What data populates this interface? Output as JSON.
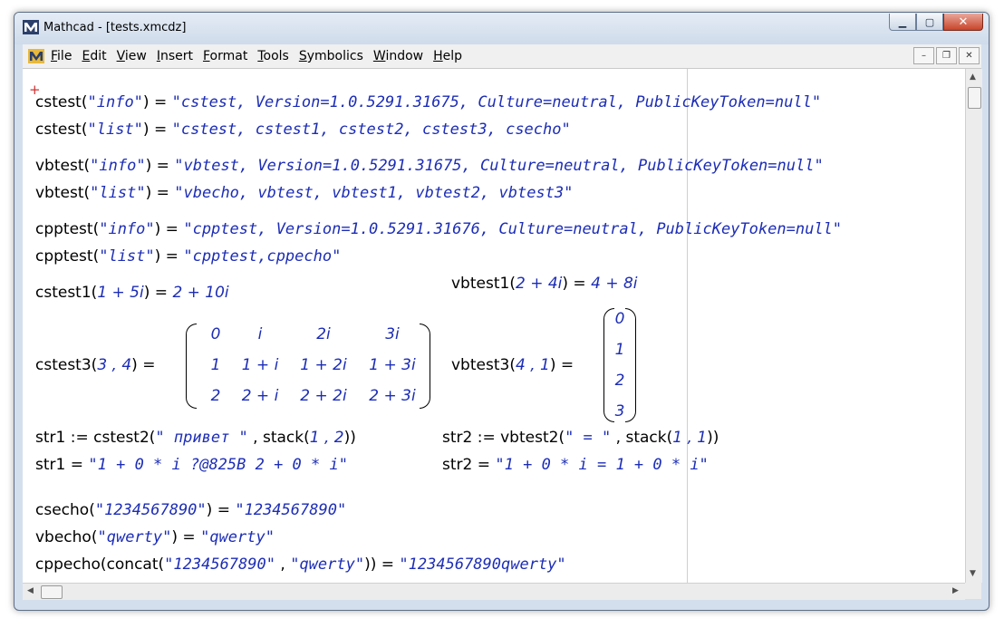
{
  "window": {
    "title": "Mathcad - [tests.xmcdz]",
    "minimize": "▁",
    "maximize": "▢",
    "close": "✕"
  },
  "menu": [
    "File",
    "Edit",
    "View",
    "Insert",
    "Format",
    "Tools",
    "Symbolics",
    "Window",
    "Help"
  ],
  "mdi": {
    "minimize": "–",
    "restore": "❐",
    "close": "✕"
  },
  "cursor_glyph": "+",
  "icons": {
    "app": "mathcad-logo-icon",
    "doc": "mathcad-document-icon"
  },
  "colors": {
    "string_literal": "#1c2db6",
    "cursor": "#d03030"
  },
  "worksheet": {
    "cstest_info": {
      "fn": "cstest",
      "arg": "\"info\"",
      "op": " = ",
      "result": "\"cstest, Version=1.0.5291.31675, Culture=neutral, PublicKeyToken=null\""
    },
    "cstest_list": {
      "fn": "cstest",
      "arg": "\"list\"",
      "op": " = ",
      "result": "\"cstest, cstest1, cstest2, cstest3, csecho\""
    },
    "vbtest_info": {
      "fn": "vbtest",
      "arg": "\"info\"",
      "op": " = ",
      "result": "\"vbtest, Version=1.0.5291.31675, Culture=neutral, PublicKeyToken=null\""
    },
    "vbtest_list": {
      "fn": "vbtest",
      "arg": "\"list\"",
      "op": " = ",
      "result": "\"vbecho, vbtest, vbtest1, vbtest2, vbtest3\""
    },
    "cpptest_info": {
      "fn": "cpptest",
      "arg": "\"info\"",
      "op": " = ",
      "result": "\"cpptest, Version=1.0.5291.31676, Culture=neutral, PublicKeyToken=null\""
    },
    "cpptest_list": {
      "fn": "cpptest",
      "arg": "\"list\"",
      "op": " = ",
      "result": "\"cpptest,cppecho\""
    },
    "cstest1": {
      "fn": "cstest1",
      "arg": "1 + 5i",
      "op": " = ",
      "result": "2 + 10i"
    },
    "vbtest1": {
      "fn": "vbtest1",
      "arg": "2 + 4i",
      "op": " = ",
      "result": "4 + 8i"
    },
    "cstest3": {
      "fn": "cstest3",
      "arg": "3 , 4",
      "op": " = ",
      "matrix": [
        [
          "0",
          "i",
          "2i",
          "3i"
        ],
        [
          "1",
          "1 + i",
          "1 + 2i",
          "1 + 3i"
        ],
        [
          "2",
          "2 + i",
          "2 + 2i",
          "2 + 3i"
        ]
      ]
    },
    "vbtest3": {
      "fn": "vbtest3",
      "arg": "4 , 1",
      "op": " = ",
      "vector": [
        "0",
        "1",
        "2",
        "3"
      ]
    },
    "str1_def": {
      "name": "str1",
      "op": " := ",
      "fn": "cstest2",
      "arg": "\" привет \"",
      "rest": " , stack",
      "stack_args": "1 , 2"
    },
    "str2_def": {
      "name": "str2",
      "op": " := ",
      "fn": "vbtest2",
      "arg": "\" = \"",
      "rest": " , stack",
      "stack_args": "1 , 1"
    },
    "str1_val": {
      "name": "str1",
      "op": " = ",
      "result": "\"1 + 0 * i ?@825B 2 + 0 * i\""
    },
    "str2_val": {
      "name": "str2",
      "op": " = ",
      "result": "\"1 + 0 * i = 1 + 0 * i\""
    },
    "csecho": {
      "fn": "csecho",
      "arg": "\"1234567890\"",
      "op": " = ",
      "result": "\"1234567890\""
    },
    "vbecho": {
      "fn": "vbecho",
      "arg": "\"qwerty\"",
      "op": " = ",
      "result": "\"qwerty\""
    },
    "cppecho": {
      "fn": "cppecho",
      "inner_fn": "concat",
      "arg1": "\"1234567890\"",
      "sep": " , ",
      "arg2": "\"qwerty\"",
      "op": " = ",
      "result": "\"1234567890qwerty\""
    }
  }
}
